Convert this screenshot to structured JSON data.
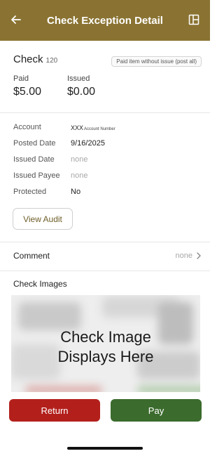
{
  "header": {
    "title": "Check Exception Detail",
    "back_icon": "arrow-left-icon",
    "layout_icon": "layout-panel-icon",
    "background": "#8a7332"
  },
  "check": {
    "label": "Check",
    "number": "120",
    "status": "Paid item without issue (post all)",
    "paid_label": "Paid",
    "paid_value": "$5.00",
    "issued_label": "Issued",
    "issued_value": "$0.00"
  },
  "details": {
    "account": {
      "label": "Account",
      "value": "XXX",
      "suffix": "Account Number"
    },
    "posted_date": {
      "label": "Posted Date",
      "value": "9/16/2025"
    },
    "issued_date": {
      "label": "Issued Date",
      "value": "none"
    },
    "issued_payee": {
      "label": "Issued Payee",
      "value": "none"
    },
    "protected": {
      "label": "Protected",
      "value": "No"
    }
  },
  "view_audit_label": "View Audit",
  "comment": {
    "label": "Comment",
    "value": "none"
  },
  "check_images": {
    "label": "Check Images",
    "caption_line1": "Check Image",
    "caption_line2": "Displays Here"
  },
  "actions": {
    "return_label": "Return",
    "pay_label": "Pay",
    "return_color": "#b3201c",
    "pay_color": "#3b6b2d"
  }
}
